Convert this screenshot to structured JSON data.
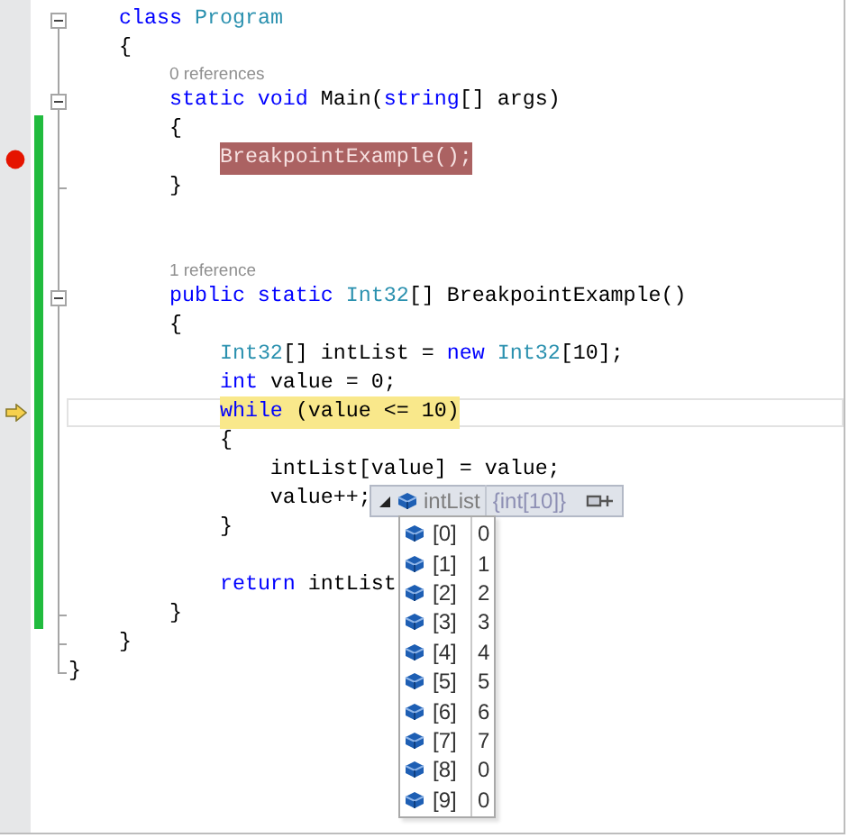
{
  "lines": [
    {
      "children": [
        {
          "kind": "fold_start",
          "tokens": [
            {
              "text": "class ",
              "kind": "keyword"
            },
            {
              "text": "Program",
              "kind": "type"
            }
          ]
        },
        {
          "kind": "code",
          "tokens": [
            {
              "text": "{",
              "kind": "plain"
            }
          ]
        },
        {
          "children": [
            {
              "kind": "codelens",
              "label": "0 references"
            },
            {
              "kind": "fold_start",
              "tokens": [
                {
                  "text": "static void ",
                  "kind": "keyword"
                },
                {
                  "text": "Main(",
                  "kind": "plain"
                },
                {
                  "text": "string",
                  "kind": "keyword"
                },
                {
                  "text": "[] args)",
                  "kind": "plain"
                }
              ]
            },
            {
              "kind": "code",
              "tokens": [
                {
                  "text": "{",
                  "kind": "plain"
                }
              ],
              "changed": true
            },
            {
              "children": [
                {
                  "kind": "code",
                  "tokens": [
                    {
                      "text": "BreakpointExample();",
                      "kind": "plain"
                    }
                  ],
                  "changed": true,
                  "breakpoint": true
                }
              ]
            },
            {
              "kind": "fold_end",
              "tokens": [
                {
                  "text": "}",
                  "kind": "plain"
                }
              ],
              "changed": true
            },
            {
              "kind": "blank",
              "changed": true
            },
            {
              "kind": "blank",
              "changed": true
            },
            {
              "kind": "codelens",
              "label": "1 reference",
              "changed": true
            },
            {
              "kind": "fold_start",
              "tokens": [
                {
                  "text": "public static ",
                  "kind": "keyword"
                },
                {
                  "text": "Int32",
                  "kind": "type"
                },
                {
                  "text": "[] BreakpointExample()",
                  "kind": "plain"
                }
              ],
              "changed": true
            },
            {
              "kind": "code",
              "tokens": [
                {
                  "text": "{",
                  "kind": "plain"
                }
              ],
              "changed": true
            },
            {
              "children": [
                {
                  "kind": "code",
                  "tokens": [
                    {
                      "text": "Int32",
                      "kind": "type"
                    },
                    {
                      "text": "[] intList = ",
                      "kind": "plain"
                    },
                    {
                      "text": "new ",
                      "kind": "keyword"
                    },
                    {
                      "text": "Int32",
                      "kind": "type"
                    },
                    {
                      "text": "[10];",
                      "kind": "plain"
                    }
                  ],
                  "changed": true
                },
                {
                  "kind": "code",
                  "tokens": [
                    {
                      "text": "int ",
                      "kind": "keyword"
                    },
                    {
                      "text": "value = 0;",
                      "kind": "plain"
                    }
                  ],
                  "changed": true
                },
                {
                  "kind": "code",
                  "tokens": [
                    {
                      "text": "while ",
                      "kind": "keyword"
                    },
                    {
                      "text": "(value <= 10)",
                      "kind": "plain"
                    }
                  ],
                  "changed": true,
                  "current": true
                },
                {
                  "kind": "code",
                  "tokens": [
                    {
                      "text": "{",
                      "kind": "plain"
                    }
                  ],
                  "changed": true
                },
                {
                  "children": [
                    {
                      "kind": "code",
                      "tokens": [
                        {
                          "text": "intList[value] = value;",
                          "kind": "plain"
                        }
                      ],
                      "changed": true
                    },
                    {
                      "kind": "code",
                      "tokens": [
                        {
                          "text": "value++;",
                          "kind": "plain"
                        }
                      ],
                      "changed": true
                    }
                  ]
                },
                {
                  "kind": "code",
                  "tokens": [
                    {
                      "text": "}",
                      "kind": "plain"
                    }
                  ],
                  "changed": true
                },
                {
                  "kind": "blank",
                  "changed": true
                },
                {
                  "kind": "code",
                  "tokens": [
                    {
                      "text": "return ",
                      "kind": "keyword"
                    },
                    {
                      "text": "intList",
                      "kind": "plain"
                    }
                  ],
                  "changed": true
                }
              ]
            },
            {
              "kind": "fold_end",
              "tokens": [
                {
                  "text": "}",
                  "kind": "plain"
                }
              ],
              "changed": true
            }
          ]
        },
        {
          "kind": "fold_end",
          "tokens": [
            {
              "text": "}",
              "kind": "plain"
            }
          ]
        }
      ]
    },
    {
      "kind": "fold_end",
      "tokens": [
        {
          "text": "}",
          "kind": "plain"
        }
      ]
    }
  ],
  "datatip": {
    "expanded": true,
    "name": "intList",
    "value": "{int[10]}",
    "items": [
      {
        "index": "[0]",
        "value": "0"
      },
      {
        "index": "[1]",
        "value": "1"
      },
      {
        "index": "[2]",
        "value": "2"
      },
      {
        "index": "[3]",
        "value": "3"
      },
      {
        "index": "[4]",
        "value": "4"
      },
      {
        "index": "[5]",
        "value": "5"
      },
      {
        "index": "[6]",
        "value": "6"
      },
      {
        "index": "[7]",
        "value": "7"
      },
      {
        "index": "[8]",
        "value": "0"
      },
      {
        "index": "[9]",
        "value": "0"
      }
    ]
  }
}
